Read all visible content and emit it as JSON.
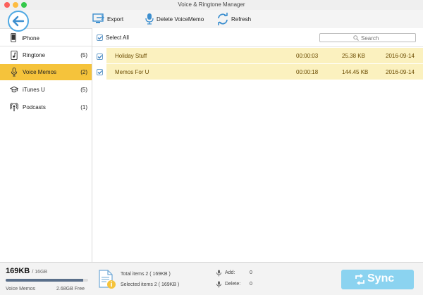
{
  "window": {
    "title": "Voice & Ringtone Manager"
  },
  "toolbar": {
    "export_label": "Export",
    "delete_label": "Delete VoiceMemo",
    "refresh_label": "Refresh"
  },
  "sidebar": {
    "device": "iPhone",
    "items": [
      {
        "label": "Ringtone",
        "count": "(5)"
      },
      {
        "label": "Voice Memos",
        "count": "(2)"
      },
      {
        "label": "iTunes U",
        "count": "(5)"
      },
      {
        "label": "Podcasts",
        "count": "(1)"
      }
    ]
  },
  "list": {
    "select_all_label": "Select All",
    "search_placeholder": "Search",
    "rows": [
      {
        "name": "Holiday Stuff",
        "duration": "00:00:03",
        "size": "25.38 KB",
        "date": "2016-09-14"
      },
      {
        "name": "Memos For U",
        "duration": "00:00:18",
        "size": "144.45 KB",
        "date": "2016-09-14"
      }
    ]
  },
  "footer": {
    "used": "169KB",
    "capacity": "/ 16GB",
    "storage_fill_percent": 94,
    "type_label": "Voice Memos",
    "free": "2.68GB Free",
    "total_items": "Total items 2 ( 169KB )",
    "selected_items": "Selected items 2 ( 169KB )",
    "add_label": "Add:",
    "add_value": "0",
    "delete_label": "Delete:",
    "delete_value": "0",
    "sync_label": "Sync"
  },
  "colors": {
    "accent": "#f5c33b",
    "row_highlight": "#fbf1bf",
    "sync_button": "#8bd3f0",
    "back_button": "#4fa9e3"
  }
}
